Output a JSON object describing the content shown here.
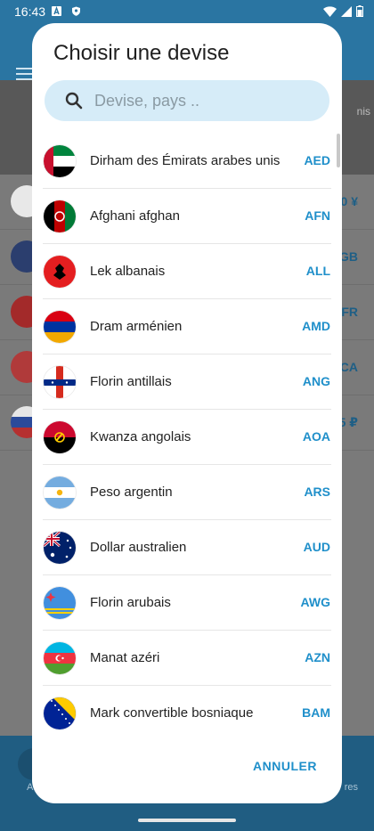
{
  "status_bar": {
    "time": "16:43"
  },
  "background": {
    "banner_text": "nis",
    "values": [
      "0 ¥",
      "GB",
      "FR",
      "CA",
      "5 ₽"
    ],
    "bottom_left": "A",
    "bottom_right": "res"
  },
  "dialog": {
    "title": "Choisir une devise",
    "search_placeholder": "Devise, pays ..",
    "cancel_label": "ANNULER",
    "accent_color": "#1f8fca",
    "currencies": [
      {
        "name": "Dirham des Émirats arabes unis",
        "code": "AED",
        "flag": "uae-flag-icon"
      },
      {
        "name": "Afghani afghan",
        "code": "AFN",
        "flag": "afghanistan-flag-icon"
      },
      {
        "name": "Lek albanais",
        "code": "ALL",
        "flag": "albania-flag-icon"
      },
      {
        "name": "Dram arménien",
        "code": "AMD",
        "flag": "armenia-flag-icon"
      },
      {
        "name": "Florin antillais",
        "code": "ANG",
        "flag": "netherlands-antilles-flag-icon"
      },
      {
        "name": "Kwanza angolais",
        "code": "AOA",
        "flag": "angola-flag-icon"
      },
      {
        "name": "Peso argentin",
        "code": "ARS",
        "flag": "argentina-flag-icon"
      },
      {
        "name": "Dollar australien",
        "code": "AUD",
        "flag": "australia-flag-icon"
      },
      {
        "name": "Florin arubais",
        "code": "AWG",
        "flag": "aruba-flag-icon"
      },
      {
        "name": "Manat azéri",
        "code": "AZN",
        "flag": "azerbaijan-flag-icon"
      },
      {
        "name": "Mark convertible bosniaque",
        "code": "BAM",
        "flag": "bosnia-flag-icon"
      }
    ]
  }
}
